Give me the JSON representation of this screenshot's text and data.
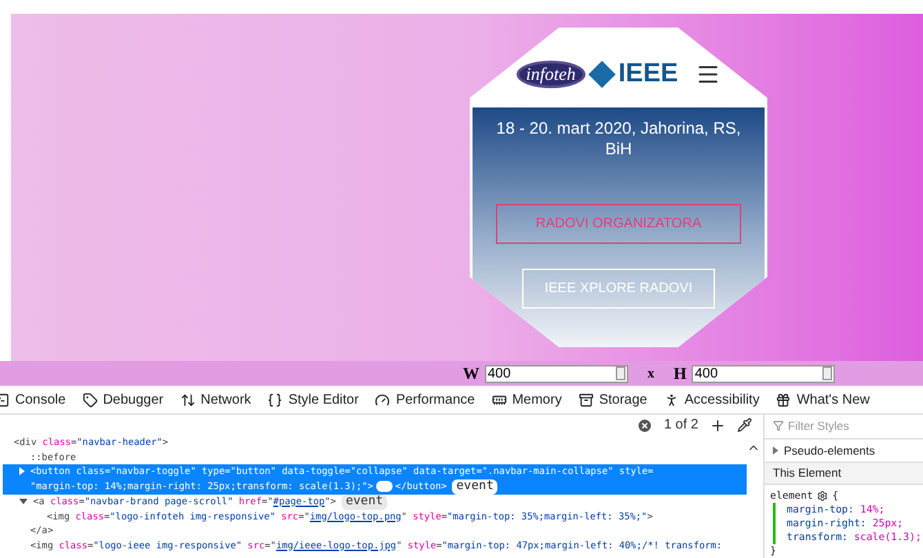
{
  "preview": {
    "date": "18 - 20. mart 2020, Jahorina, RS, BiH",
    "overlay_link": "RADOVI ORGANIZATORA",
    "button": "IEEE XPLORE RADOVI",
    "logo_left": "infoteh",
    "logo_right": "IEEE"
  },
  "size": {
    "w_label": "W",
    "w_value": "400",
    "x": "x",
    "h_label": "H",
    "h_value": "400"
  },
  "tabs": [
    {
      "label": "Console",
      "selected": false
    },
    {
      "label": "Debugger",
      "selected": false
    },
    {
      "label": "Network",
      "selected": false
    },
    {
      "label": "Style Editor",
      "selected": false
    },
    {
      "label": "Performance",
      "selected": false
    },
    {
      "label": "Memory",
      "selected": false
    },
    {
      "label": "Storage",
      "selected": false
    },
    {
      "label": "Accessibility",
      "selected": false
    },
    {
      "label": "What's New",
      "selected": false
    }
  ],
  "search": {
    "count": "1 of 2"
  },
  "markup": [
    {
      "selected": false,
      "segments": [
        {
          "kind": "tag",
          "text": "<div "
        },
        {
          "kind": "attr",
          "text": "class"
        },
        {
          "kind": "tag",
          "text": "="
        },
        {
          "kind": "value",
          "text": "\"navbar-header\""
        },
        {
          "kind": "tag",
          "text": ">"
        }
      ],
      "children": [
        {
          "selected": false,
          "segments": [
            {
              "kind": "pseudo",
              "text": "::before"
            }
          ]
        },
        {
          "selected": true,
          "expanded": false,
          "segments": [
            {
              "kind": "tag",
              "text": "<button "
            },
            {
              "kind": "attr",
              "text": "class"
            },
            {
              "kind": "tag",
              "text": "="
            },
            {
              "kind": "value",
              "text": "\"navbar-toggle\" "
            },
            {
              "kind": "attr",
              "text": "type"
            },
            {
              "kind": "tag",
              "text": "="
            },
            {
              "kind": "value",
              "text": "\"button\" "
            },
            {
              "kind": "attr",
              "text": "data-toggle"
            },
            {
              "kind": "tag",
              "text": "="
            },
            {
              "kind": "value",
              "text": "\"collapse\" "
            },
            {
              "kind": "attr",
              "text": "data-target"
            },
            {
              "kind": "tag",
              "text": "="
            },
            {
              "kind": "value",
              "text": "\".navbar-main-collapse\" "
            },
            {
              "kind": "attr",
              "text": "style"
            },
            {
              "kind": "tag",
              "text": "="
            },
            {
              "kind": "value",
              "text": "\"margin-top: 14%;margin-right: 25px;transform: scale(1.3);\""
            },
            {
              "kind": "tag",
              "text": ">"
            },
            {
              "kind": "ellipsis"
            },
            {
              "kind": "tag",
              "text": "</button>"
            },
            {
              "kind": "badge",
              "text": "event"
            }
          ]
        },
        {
          "selected": false,
          "expanded": true,
          "segments": [
            {
              "kind": "tag",
              "text": "<a "
            },
            {
              "kind": "attr",
              "text": "class"
            },
            {
              "kind": "tag",
              "text": "="
            },
            {
              "kind": "value",
              "text": "\"navbar-brand page-scroll\" "
            },
            {
              "kind": "attr",
              "text": "href"
            },
            {
              "kind": "tag",
              "text": "=\""
            },
            {
              "kind": "link",
              "text": "#page-top"
            },
            {
              "kind": "tag",
              "text": "\">"
            },
            {
              "kind": "badge",
              "text": "event"
            }
          ],
          "children": [
            {
              "selected": false,
              "segments": [
                {
                  "kind": "tag",
                  "text": "<img "
                },
                {
                  "kind": "attr",
                  "text": "class"
                },
                {
                  "kind": "tag",
                  "text": "="
                },
                {
                  "kind": "value",
                  "text": "\"logo-infoteh img-responsive\" "
                },
                {
                  "kind": "attr",
                  "text": "src"
                },
                {
                  "kind": "tag",
                  "text": "=\""
                },
                {
                  "kind": "link",
                  "text": "img/logo-top.png"
                },
                {
                  "kind": "tag",
                  "text": "\" "
                },
                {
                  "kind": "attr",
                  "text": "style"
                },
                {
                  "kind": "tag",
                  "text": "="
                },
                {
                  "kind": "value",
                  "text": "\"margin-top: 35%;margin-left: 35%;\""
                },
                {
                  "kind": "tag",
                  "text": ">"
                }
              ]
            }
          ],
          "closing": "</a>"
        },
        {
          "selected": false,
          "segments": [
            {
              "kind": "tag",
              "text": "<img "
            },
            {
              "kind": "attr",
              "text": "class"
            },
            {
              "kind": "tag",
              "text": "="
            },
            {
              "kind": "value",
              "text": "\"logo-ieee img-responsive\" "
            },
            {
              "kind": "attr",
              "text": "src"
            },
            {
              "kind": "tag",
              "text": "=\""
            },
            {
              "kind": "link",
              "text": "img/ieee-logo-top.jpg"
            },
            {
              "kind": "tag",
              "text": "\" "
            },
            {
              "kind": "attr",
              "text": "style"
            },
            {
              "kind": "tag",
              "text": "="
            },
            {
              "kind": "value",
              "text": "\"margin-top: 47px;margin-left: 40%;/*! transform:"
            }
          ]
        }
      ]
    }
  ],
  "rules": {
    "filter_placeholder": "Filter Styles",
    "pseudo": "Pseudo-elements",
    "pseudo_expanded": false,
    "section": "This Element",
    "selector": "element",
    "open_brace": "{",
    "declarations": [
      {
        "name": "margin-top:",
        "value": "14%;"
      },
      {
        "name": "margin-right:",
        "value": "25px;"
      },
      {
        "name": "transform:",
        "value": "scale(1.3);"
      }
    ],
    "close_brace": "}"
  }
}
